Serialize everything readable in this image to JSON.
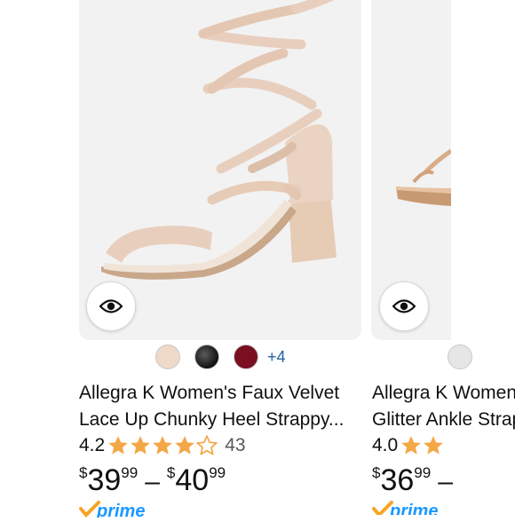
{
  "products": [
    {
      "title": "Allegra K Women's Faux Velvet Lace Up Chunky Heel Strappy...",
      "rating": "4.2",
      "rating_value": 4.2,
      "review_count": "43",
      "price_low": {
        "currency": "$",
        "whole": "39",
        "fraction": "99"
      },
      "price_separator": "–",
      "price_high": {
        "currency": "$",
        "whole": "40",
        "fraction": "99"
      },
      "color_swatches": [
        "#efd9c9",
        "#1b1b1b",
        "#7a0f22"
      ],
      "more_colors": "+4",
      "prime_label": "prime"
    },
    {
      "title": "Allegra K Women's Glitter Ankle Strap Heel",
      "rating": "4.0",
      "rating_value": 4.0,
      "price_low": {
        "currency": "$",
        "whole": "36",
        "fraction": "99"
      },
      "price_separator": "–",
      "prime_label": "prime"
    }
  ],
  "colors": {
    "star": "#f3a847",
    "link": "#2162a1",
    "prime_check": "#f7a423",
    "prime_text": "#1a98ff",
    "image_bg": "#f2f2f2"
  }
}
